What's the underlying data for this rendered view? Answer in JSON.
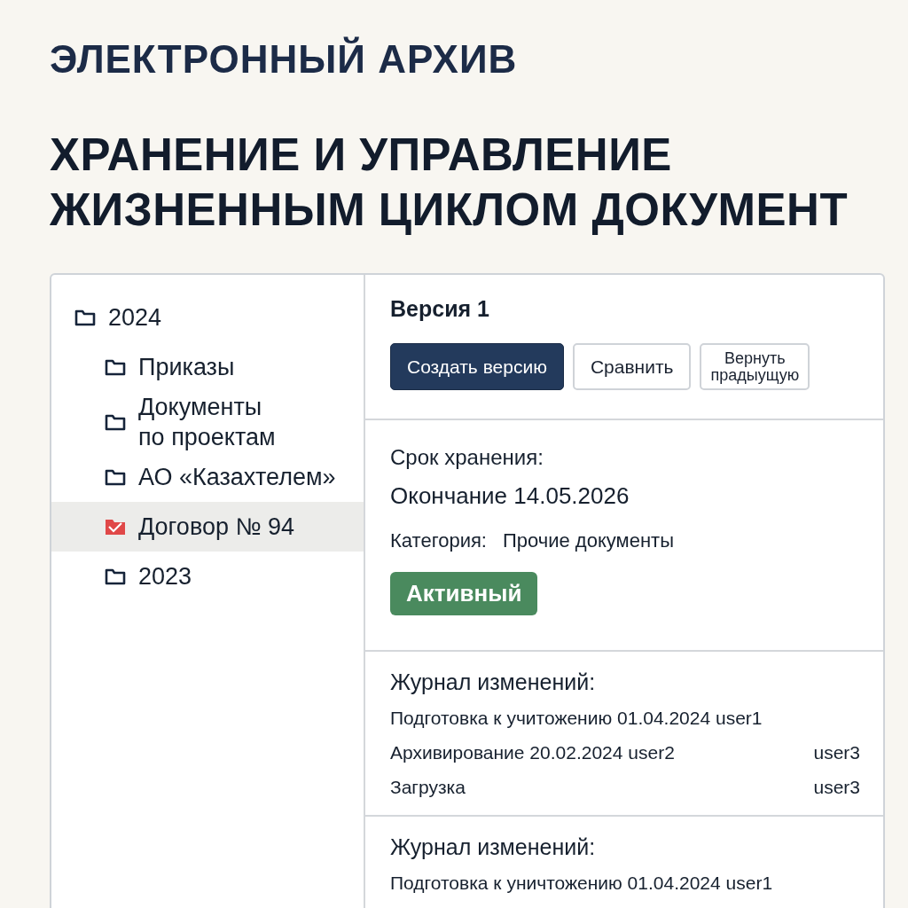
{
  "app_title": "ЭЛЕКТРОННЫЙ АРХИВ",
  "heading": "ХРАНЕНИЕ И УПРАВЛЕНИЕ ЖИЗНЕННЫМ ЦИКЛОМ ДОКУМЕНТ",
  "tree": [
    {
      "label": "2024",
      "kind": "folder",
      "selected": false,
      "children": [
        {
          "label": "Приказы",
          "kind": "folder",
          "selected": false
        },
        {
          "label": "Документы\nпо проектам",
          "kind": "folder",
          "selected": false
        },
        {
          "label": "АО «Казахтелем»",
          "kind": "folder",
          "selected": false
        },
        {
          "label": "Договор № 94",
          "kind": "document",
          "selected": true
        },
        {
          "label": "2023",
          "kind": "folder",
          "selected": false
        }
      ]
    }
  ],
  "version": {
    "title": "Версия 1",
    "buttons": [
      {
        "label": "Создать версию",
        "kind": "primary"
      },
      {
        "label": "Сравнить",
        "kind": "secondary"
      },
      {
        "label": "Вернуть\nпрадыущую",
        "kind": "secondary"
      }
    ]
  },
  "retention": {
    "label": "Срок хранения:",
    "end": "Окончание 14.05.2026",
    "category_label": "Категория:",
    "category": "Прочие документы",
    "status": {
      "label": "Активный",
      "kind": "active"
    }
  },
  "journals": [
    {
      "title": "Журнал изменений:",
      "entries": [
        {
          "text": "Подготовка к учитожению 01.04.2024 user1"
        },
        {
          "text": "Архивирование 20.02.2024 user2",
          "user": "user3"
        },
        {
          "text": "Загрузка",
          "user": "user3"
        }
      ]
    },
    {
      "title": "Журнал изменений:",
      "entries": [
        {
          "text": "Подготовка к уничтожению 01.04.2024 user1"
        }
      ]
    }
  ]
}
